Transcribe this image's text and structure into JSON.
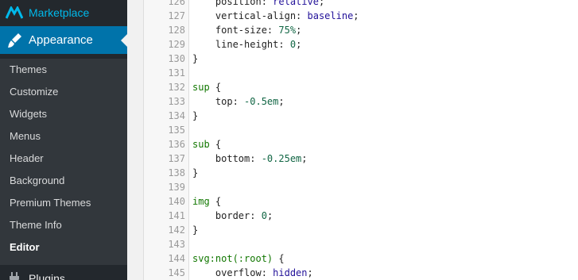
{
  "sidebar": {
    "marketplace": {
      "label": "Marketplace",
      "icon": "marketplace-logo-icon"
    },
    "appearance": {
      "label": "Appearance",
      "icon": "paintbrush-icon"
    },
    "submenu": [
      {
        "label": "Themes",
        "current": false
      },
      {
        "label": "Customize",
        "current": false
      },
      {
        "label": "Widgets",
        "current": false
      },
      {
        "label": "Menus",
        "current": false
      },
      {
        "label": "Header",
        "current": false
      },
      {
        "label": "Background",
        "current": false
      },
      {
        "label": "Premium Themes",
        "current": false
      },
      {
        "label": "Theme Info",
        "current": false
      },
      {
        "label": "Editor",
        "current": true
      }
    ],
    "plugins": {
      "label": "Plugins",
      "icon": "plugins-icon"
    }
  },
  "editor": {
    "lines": [
      {
        "n": "126",
        "code": "    position: relative;"
      },
      {
        "n": "127",
        "code": "    vertical-align: baseline;"
      },
      {
        "n": "128",
        "code": "    font-size: 75%;"
      },
      {
        "n": "129",
        "code": "    line-height: 0;"
      },
      {
        "n": "130",
        "code": "}"
      },
      {
        "n": "131",
        "code": ""
      },
      {
        "n": "132",
        "code": "sup {"
      },
      {
        "n": "133",
        "code": "    top: -0.5em;"
      },
      {
        "n": "134",
        "code": "}"
      },
      {
        "n": "135",
        "code": ""
      },
      {
        "n": "136",
        "code": "sub {"
      },
      {
        "n": "137",
        "code": "    bottom: -0.25em;"
      },
      {
        "n": "138",
        "code": "}"
      },
      {
        "n": "139",
        "code": ""
      },
      {
        "n": "140",
        "code": "img {"
      },
      {
        "n": "141",
        "code": "    border: 0;"
      },
      {
        "n": "142",
        "code": "}"
      },
      {
        "n": "143",
        "code": ""
      },
      {
        "n": "144",
        "code": "svg:not(:root) {"
      },
      {
        "n": "145",
        "code": "    overflow: hidden;"
      }
    ]
  },
  "colors": {
    "sidebar_bg": "#23282d",
    "submenu_bg": "#32373c",
    "active_bg": "#0073aa",
    "marketplace_accent": "#00b9eb",
    "selector": "#117700",
    "keyword": "#221199",
    "number": "#116644"
  }
}
